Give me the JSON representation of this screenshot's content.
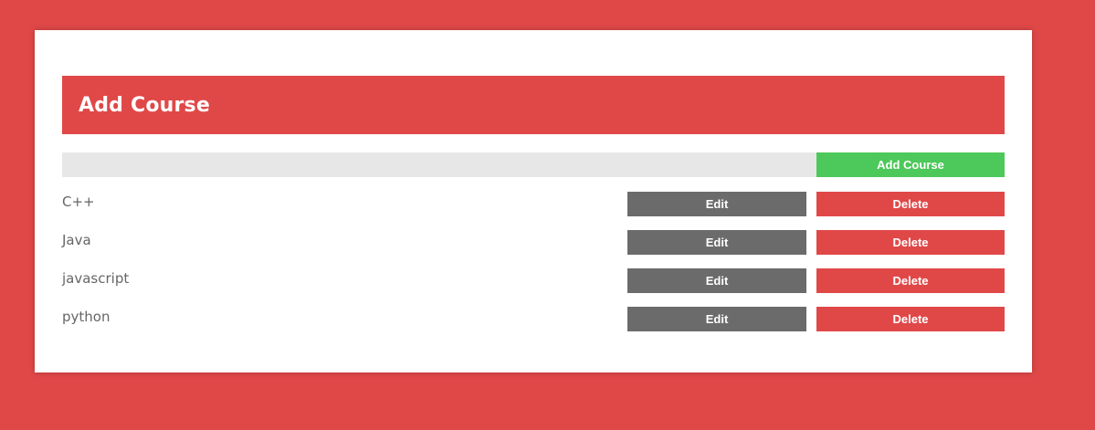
{
  "header": {
    "title": "Add Course"
  },
  "add_form": {
    "input_value": "",
    "placeholder": "",
    "button_label": "Add Course"
  },
  "courses": [
    {
      "name": "C++",
      "edit_label": "Edit",
      "delete_label": "Delete"
    },
    {
      "name": "Java",
      "edit_label": "Edit",
      "delete_label": "Delete"
    },
    {
      "name": "javascript",
      "edit_label": "Edit",
      "delete_label": "Delete"
    },
    {
      "name": "python",
      "edit_label": "Edit",
      "delete_label": "Delete"
    }
  ],
  "colors": {
    "accent_red": "#e04848",
    "add_green": "#4dc85a",
    "edit_gray": "#6b6b6b",
    "input_gray": "#e7e7e7"
  }
}
